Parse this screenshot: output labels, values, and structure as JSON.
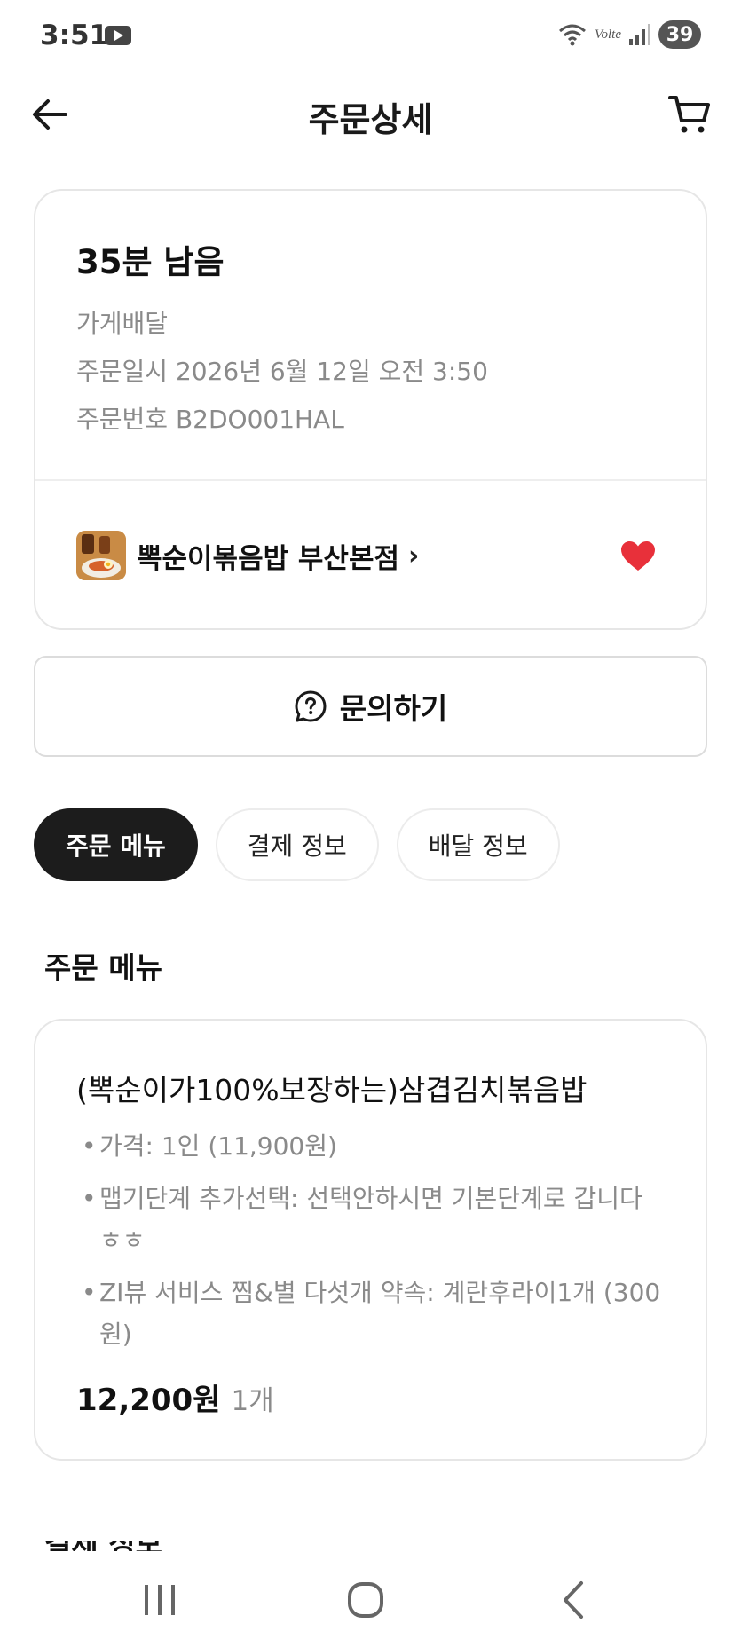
{
  "status_bar": {
    "time": "3:51",
    "network_label": "Volte",
    "battery": "39"
  },
  "header": {
    "title": "주문상세"
  },
  "order": {
    "remaining": "35분 남음",
    "delivery_type": "가게배달",
    "order_datetime": "주문일시 2026년 6월 12일 오전 3:50",
    "order_number": "주문번호 B2DO001HAL",
    "store_name": "뽁순이볶음밥 부산본점",
    "store_chevron": "›",
    "favorite": true
  },
  "inquiry": {
    "label": "문의하기"
  },
  "tabs": [
    {
      "label": "주문 메뉴",
      "active": true
    },
    {
      "label": "결제 정보",
      "active": false
    },
    {
      "label": "배달 정보",
      "active": false
    }
  ],
  "section_title": "주문 메뉴",
  "menu_item": {
    "name": "(뽁순이가100%보장하는)삼겹김치볶음밥",
    "options": [
      "가격: 1인 (11,900원)",
      "맵기단계 추가선택: 선택안하시면 기본단계로 갑니다 ㅎㅎ",
      "ZI뷰 서비스 찜&별 다섯개 약속: 계란후라이1개 (300원)"
    ],
    "price": "12,200원",
    "quantity": "1개"
  },
  "next_section_title": "결제 정보",
  "colors": {
    "accent_heart": "#e8303a",
    "active_tab_bg": "#1c1c1c",
    "muted_text": "#8a8a8a",
    "border": "#e6e6e6"
  }
}
